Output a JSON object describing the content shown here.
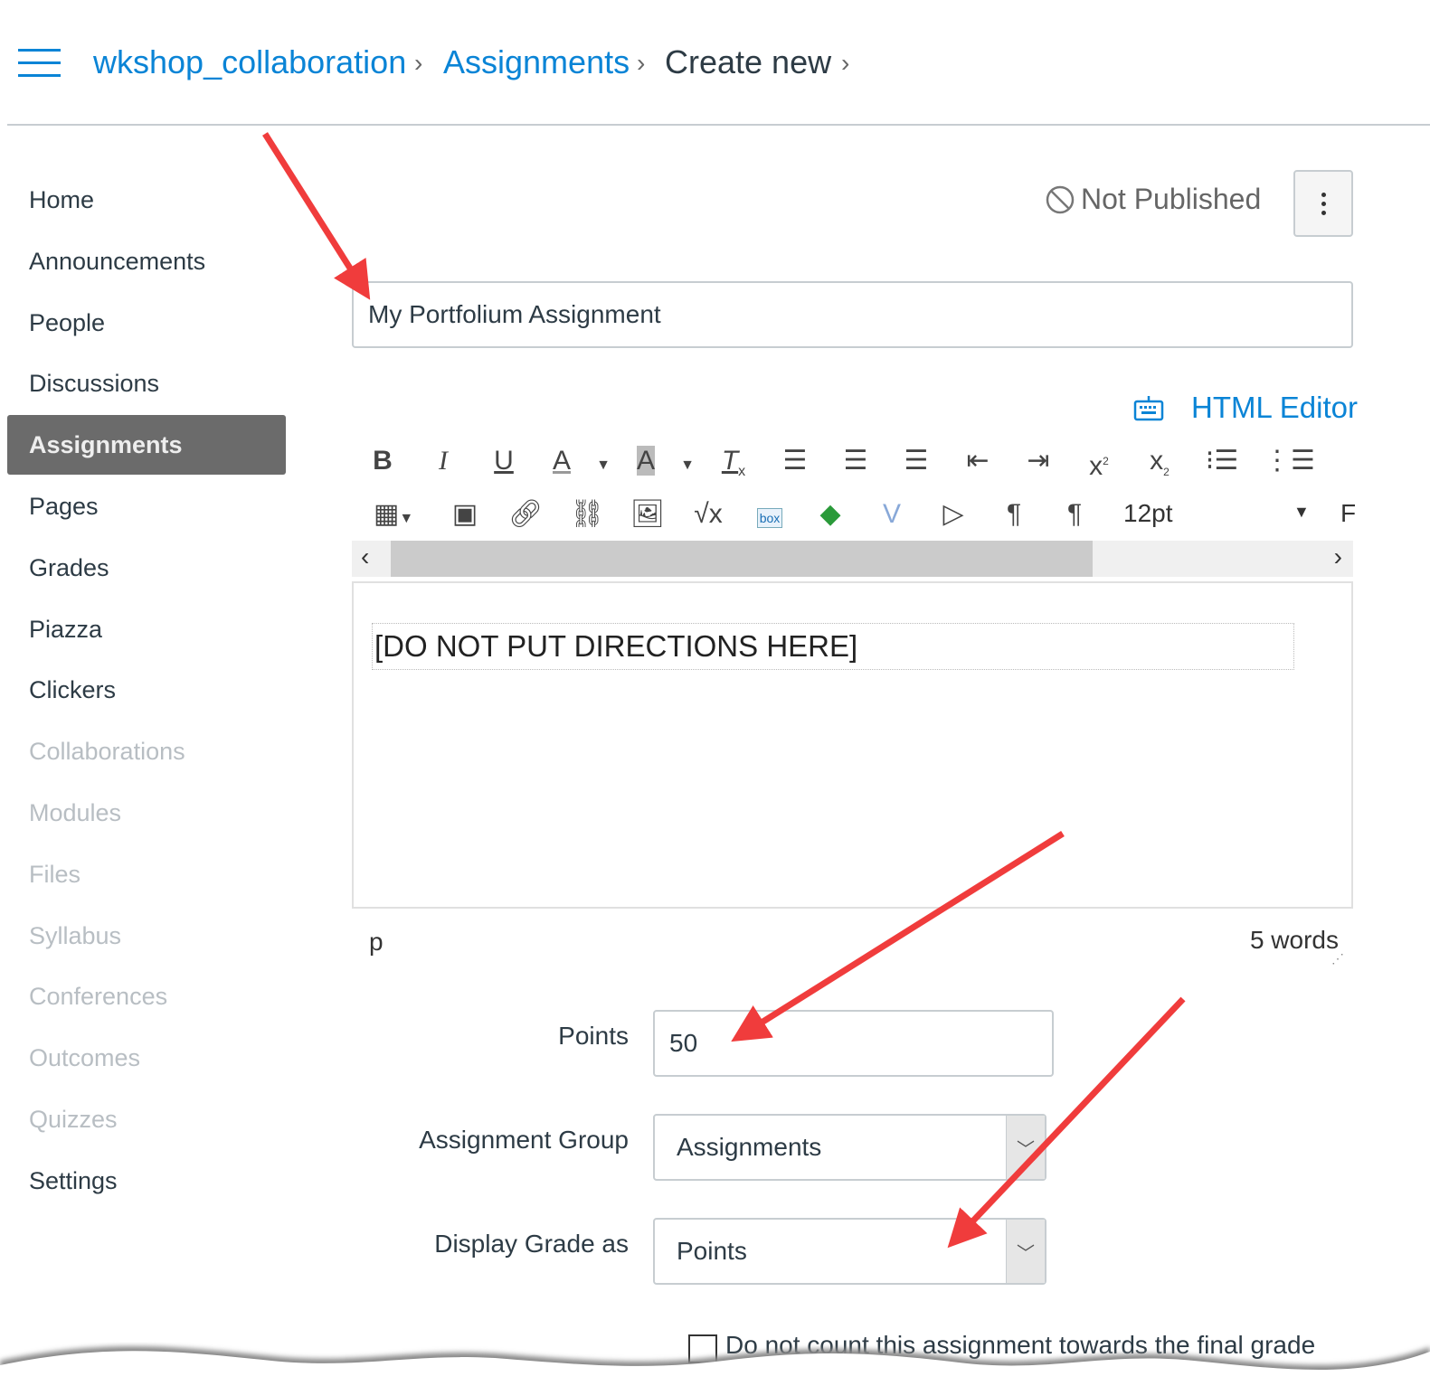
{
  "breadcrumb": {
    "course": "wkshop_collaboration",
    "section": "Assignments",
    "current": "Create new"
  },
  "sidebar": {
    "items": [
      {
        "label": "Home",
        "state": "normal"
      },
      {
        "label": "Announcements",
        "state": "normal"
      },
      {
        "label": "People",
        "state": "normal"
      },
      {
        "label": "Discussions",
        "state": "normal"
      },
      {
        "label": "Assignments",
        "state": "active"
      },
      {
        "label": "Pages",
        "state": "normal"
      },
      {
        "label": "Grades",
        "state": "normal"
      },
      {
        "label": "Piazza",
        "state": "normal"
      },
      {
        "label": "Clickers",
        "state": "normal"
      },
      {
        "label": "Collaborations",
        "state": "disabled"
      },
      {
        "label": "Modules",
        "state": "disabled"
      },
      {
        "label": "Files",
        "state": "disabled"
      },
      {
        "label": "Syllabus",
        "state": "disabled"
      },
      {
        "label": "Conferences",
        "state": "disabled"
      },
      {
        "label": "Outcomes",
        "state": "disabled"
      },
      {
        "label": "Quizzes",
        "state": "disabled"
      },
      {
        "label": "Settings",
        "state": "normal"
      }
    ]
  },
  "header": {
    "publish_status": "Not Published"
  },
  "form": {
    "title_value": "My Portfolium Assignment",
    "html_editor_label": "HTML Editor",
    "font_size": "12pt",
    "font_family_partial": "F",
    "editor_content": "[DO NOT PUT DIRECTIONS HERE]",
    "status_path": "p",
    "word_count": "5 words",
    "points_label": "Points",
    "points_value": "50",
    "group_label": "Assignment Group",
    "group_value": "Assignments",
    "display_label": "Display Grade as",
    "display_value": "Points",
    "exclude_label": "Do not count this assignment towards the final grade"
  },
  "colors": {
    "link": "#0a84d6",
    "active_nav": "#6b6b6b",
    "annotation_arrow": "#f03c3c"
  }
}
